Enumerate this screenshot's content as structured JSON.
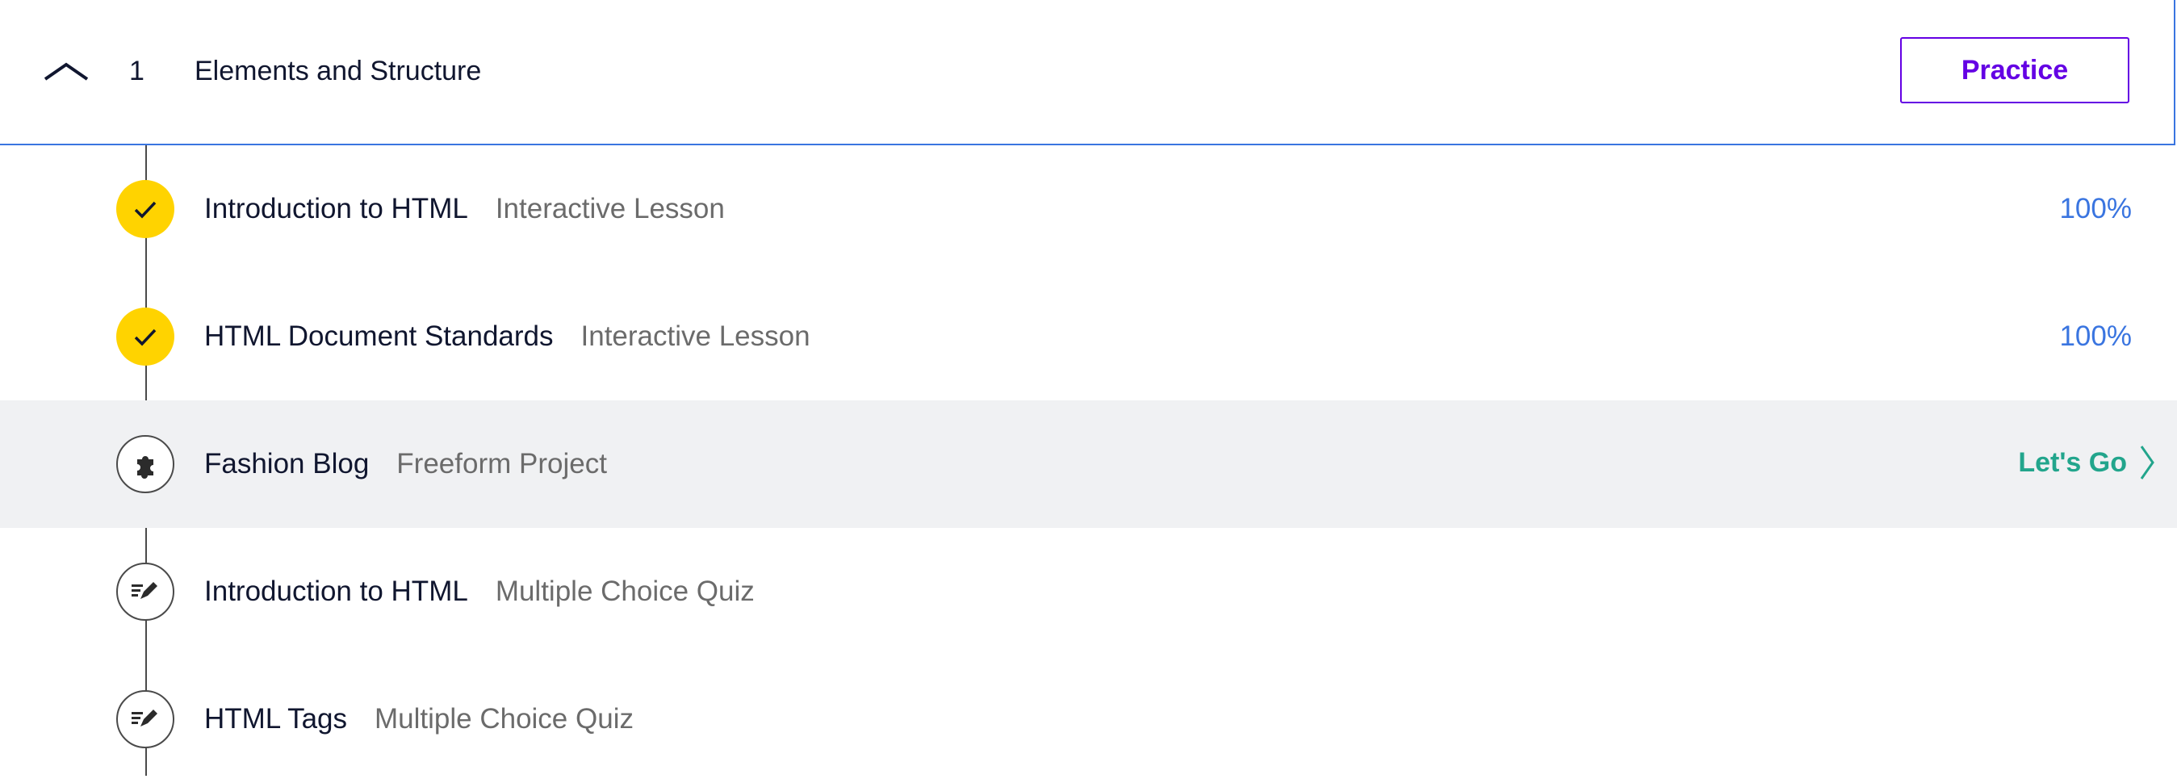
{
  "module": {
    "number": "1",
    "title": "Elements and Structure",
    "practice_label": "Practice"
  },
  "items": [
    {
      "title": "Introduction to HTML",
      "type": "Interactive Lesson",
      "status": "completed",
      "icon": "check-icon",
      "progress": "100%"
    },
    {
      "title": "HTML Document Standards",
      "type": "Interactive Lesson",
      "status": "completed",
      "icon": "check-icon",
      "progress": "100%"
    },
    {
      "title": "Fashion Blog",
      "type": "Freeform Project",
      "status": "current",
      "icon": "puzzle-icon",
      "action_label": "Let's Go"
    },
    {
      "title": "Introduction to HTML",
      "type": "Multiple Choice Quiz",
      "status": "not-started",
      "icon": "quiz-pencil-icon"
    },
    {
      "title": "HTML Tags",
      "type": "Multiple Choice Quiz",
      "status": "not-started",
      "icon": "quiz-pencil-icon"
    }
  ],
  "colors": {
    "completed": "#ffd300",
    "progress_text": "#3a75e0",
    "practice_accent": "#6400e4",
    "action": "#22a58c",
    "active_row_bg": "#f0f1f3",
    "header_border": "#3a75e0"
  }
}
